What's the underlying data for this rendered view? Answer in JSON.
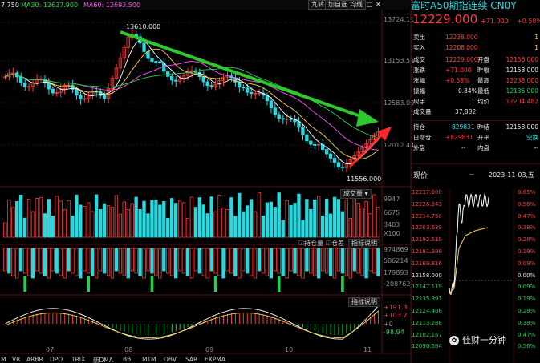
{
  "chart_header": {
    "ma_partial": "7.750",
    "ma30_label": "MA30: 12627.900",
    "ma60_label": "MA60: 12693.500"
  },
  "toolbar": {
    "nine_grid": "九转",
    "add_watch": "加自选",
    "ma_line": "均线"
  },
  "window_icons": {
    "window": "□",
    "close": "✕"
  },
  "price_axis": [
    "13724.11",
    "13153.55",
    "12583.00",
    "12012.44"
  ],
  "candle_annotations": {
    "high": "13610.000",
    "low": "11556.000"
  },
  "volume": {
    "selector": "成交量",
    "axis": [
      "9947",
      "6675",
      "3403",
      "X100"
    ],
    "toggles": [
      "持仓量",
      "仓差",
      "指标说明"
    ]
  },
  "oi_axis": [
    "974869",
    "586214",
    "179893",
    "-208762"
  ],
  "macd": {
    "explain": "指标说明",
    "axis": [
      "+191.3",
      "+103.7",
      "+0",
      "-98.94"
    ]
  },
  "x_labels": [
    "07",
    "08",
    "09",
    "10",
    "11"
  ],
  "bottom_tabs": [
    "M",
    "VR",
    "ARBR",
    "DPO",
    "TRIX",
    "新DMA",
    "BBI",
    "MTM",
    "OBV",
    "SAR",
    "EXPMA"
  ],
  "quote": {
    "title": "富时A50期指连续 CN0Y",
    "price": "12229.000",
    "change": "+71.000",
    "change_pct": "+0.58%",
    "colors": {
      "up": "#ff3b3b",
      "down": "#21d34e",
      "accent": "#ff3b3b"
    },
    "bidask": [
      {
        "label": "卖出",
        "price": "12238.000",
        "vol": "1"
      },
      {
        "label": "买入",
        "price": "12208.000",
        "vol": "1"
      }
    ],
    "stats": [
      {
        "l1": "成交",
        "v1": "12229.000",
        "l2": "开盘",
        "v2": "12156.000"
      },
      {
        "l1": "涨跌",
        "v1": "+71.000",
        "l2": "昨收",
        "v2": "12158.000"
      },
      {
        "l1": "涨幅",
        "v1": "+0.58%",
        "l2": "最高",
        "v2": "12238.000"
      },
      {
        "l1": "振幅",
        "v1": "0.84%",
        "l2": "最低",
        "v2": "12136.000"
      },
      {
        "l1": "现手",
        "v1": "1",
        "l2": "均价",
        "v2": "12204.482"
      }
    ],
    "turnover": {
      "label": "成交量",
      "value": "37,832"
    },
    "open_interest": [
      {
        "l1": "持仓",
        "v1": "829831",
        "l2": "昨结",
        "v2": "12158.000"
      },
      {
        "l1": "日增仓",
        "v1": "+829831",
        "l2": "开平",
        "v2": "空换"
      },
      {
        "l1": "外盘",
        "v1": "--",
        "l2": "内盘",
        "v2": "--"
      }
    ]
  },
  "intraday": {
    "label": "现价",
    "dash": "--",
    "date": "2023-11-03,五",
    "left_axis": [
      "12237.000",
      "12226.343",
      "12214.760",
      "12203.639",
      "12192.519",
      "12181.398",
      "12169.816",
      "12158.000",
      "12147.119",
      "12135.991",
      "12124.408",
      "12113.288",
      "12102.167",
      "12090.584"
    ],
    "right_axis": [
      "0.65%",
      "0.56%",
      "0.47%",
      "0.38%",
      "0.28%",
      "0.19%",
      "0.09%",
      "0.00%",
      "0.09%",
      "0.19%",
      "0.28%",
      "0.38%",
      "0.47%",
      "0.56%"
    ]
  },
  "watermark": "佳财一分钟"
}
